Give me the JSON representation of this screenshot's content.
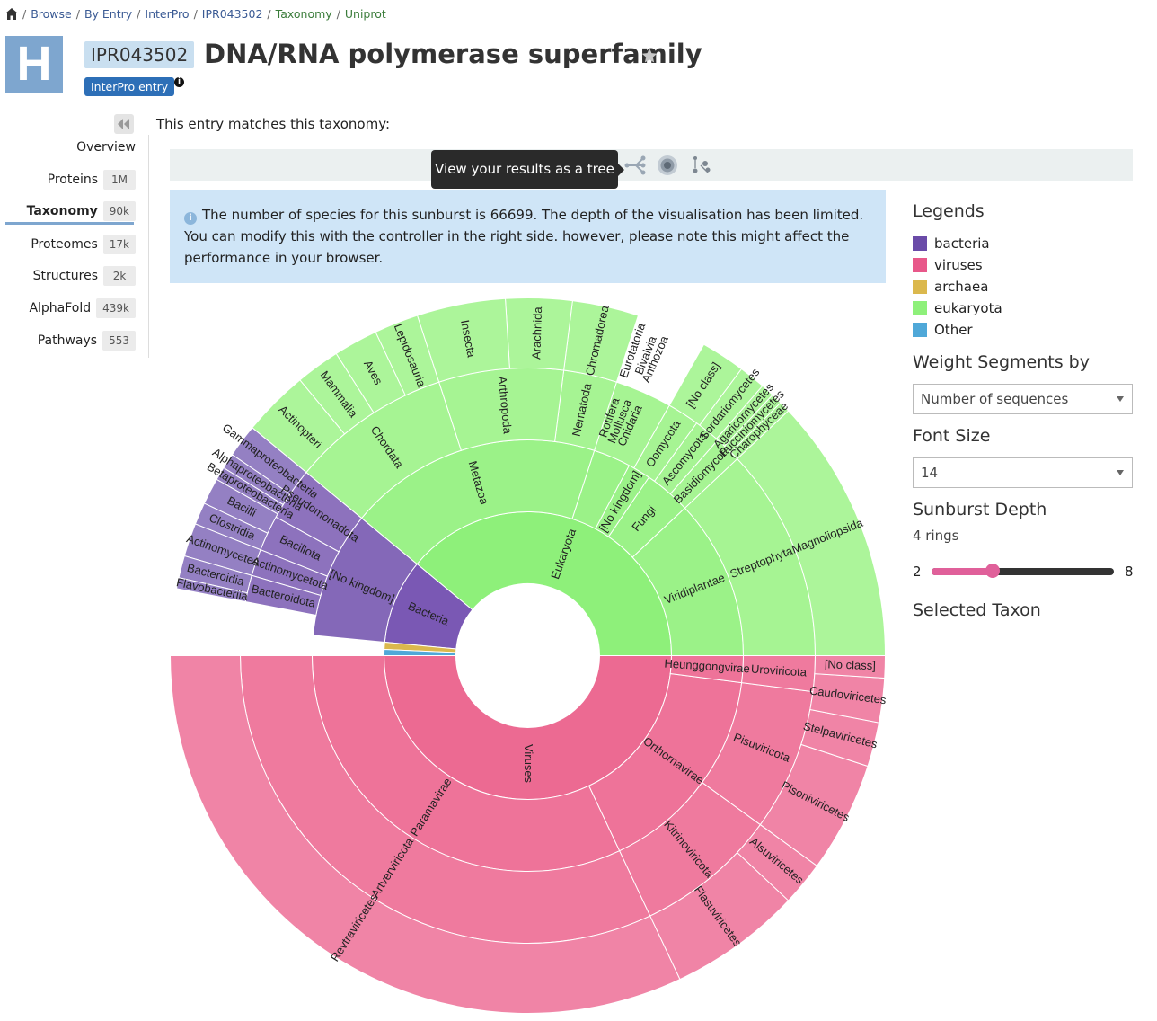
{
  "breadcrumb": [
    "Browse",
    "By Entry",
    "InterPro",
    "IPR043502",
    "Taxonomy",
    "Uniprot"
  ],
  "header": {
    "logo_letter": "H",
    "accession": "IPR043502",
    "title": "DNA/RNA polymerase superfamily",
    "type_badge": "InterPro entry",
    "info_glyph": "i"
  },
  "sidebar": {
    "items": [
      {
        "label": "Overview",
        "count": ""
      },
      {
        "label": "Proteins",
        "count": "1M"
      },
      {
        "label": "Taxonomy",
        "count": "90k"
      },
      {
        "label": "Proteomes",
        "count": "17k"
      },
      {
        "label": "Structures",
        "count": "2k"
      },
      {
        "label": "AlphaFold",
        "count": "439k"
      },
      {
        "label": "Pathways",
        "count": "553"
      }
    ]
  },
  "main": {
    "matches_text": "This entry matches this taxonomy:",
    "tooltip": "View your results as a tree",
    "callout": "The number of species for this sunburst is 66699. The depth of the visualisation has been limited. You can modify this with the controller in the right side. however, please note this might affect the performance in your browser."
  },
  "panel": {
    "legends_title": "Legends",
    "legends": [
      {
        "label": "bacteria",
        "color": "#6a4ba8"
      },
      {
        "label": "viruses",
        "color": "#e8588a"
      },
      {
        "label": "archaea",
        "color": "#dbb84d"
      },
      {
        "label": "eukaryota",
        "color": "#8ef07a"
      },
      {
        "label": "Other",
        "color": "#4fa8d8"
      }
    ],
    "weight_title": "Weight Segments by",
    "weight_value": "Number of sequences",
    "font_title": "Font Size",
    "font_value": "14",
    "depth_title": "Sunburst Depth",
    "depth_value": "4 rings",
    "depth_min": "2",
    "depth_max": "8",
    "depth_current": 4,
    "selected_title": "Selected Taxon"
  },
  "chart_data": {
    "type": "sunburst",
    "rings": [
      [
        {
          "label": "Eukaryota",
          "from": 0.0,
          "to": 0.39,
          "color": "#8ef07a"
        },
        {
          "label": "Bacteria",
          "from": 0.39,
          "to": 0.485,
          "color": "#7a58b4"
        },
        {
          "label": "",
          "from": 0.485,
          "to": 0.493,
          "color": "#dbb84d"
        },
        {
          "label": "",
          "from": 0.493,
          "to": 0.5,
          "color": "#4fa8d8"
        },
        {
          "label": "Viruses",
          "from": 0.5,
          "to": 1.0,
          "color": "#ec6a92"
        }
      ],
      [
        {
          "label": "Viridiplantae",
          "from": 0.0,
          "to": 0.12,
          "color": "#9bf288"
        },
        {
          "label": "Fungi",
          "from": 0.12,
          "to": 0.155,
          "color": "#9bf288"
        },
        {
          "label": "[No kingdom]",
          "from": 0.155,
          "to": 0.172,
          "color": "#9bf288"
        },
        {
          "label": "",
          "from": 0.172,
          "to": 0.2,
          "color": "#9bf288"
        },
        {
          "label": "[No kingdom]",
          "from": 0.39,
          "to": 0.485,
          "color": "#8468b8"
        },
        {
          "label": "Metazoa",
          "from": 0.2,
          "to": 0.39,
          "color": "#9bf288"
        },
        {
          "label": "Paramavirae",
          "from": 0.5,
          "to": 0.82,
          "color": "#ee7399"
        },
        {
          "label": "Orthornavirae",
          "from": 0.82,
          "to": 0.98,
          "color": "#ee7399"
        },
        {
          "label": "Heunggongvirae",
          "from": 0.98,
          "to": 1.0,
          "color": "#ee7399"
        }
      ],
      [
        {
          "label": "Streptophyta",
          "from": 0.0,
          "to": 0.12,
          "color": "#a6f493"
        },
        {
          "label": "Basidiomycota",
          "from": 0.12,
          "to": 0.135,
          "color": "#a6f493"
        },
        {
          "label": "Ascomycota",
          "from": 0.135,
          "to": 0.15,
          "color": "#a6f493"
        },
        {
          "label": "Oomycota",
          "from": 0.15,
          "to": 0.168,
          "color": "#a6f493"
        },
        {
          "label": "",
          "from": 0.168,
          "to": 0.2,
          "color": "#a6f493"
        },
        {
          "label": "Pseudomonadota",
          "from": 0.39,
          "to": 0.42,
          "color": "#8d72bd"
        },
        {
          "label": "Bacillota",
          "from": 0.42,
          "to": 0.44,
          "color": "#8d72bd"
        },
        {
          "label": "Actinomycetota",
          "from": 0.44,
          "to": 0.455,
          "color": "#8d72bd"
        },
        {
          "label": "Bacteroidota",
          "from": 0.455,
          "to": 0.47,
          "color": "#8d72bd"
        },
        {
          "label": "Nematoda",
          "from": 0.2,
          "to": 0.23,
          "color": "#a6f493"
        },
        {
          "label": "Arthropoda",
          "from": 0.23,
          "to": 0.3,
          "color": "#a6f493"
        },
        {
          "label": "Chordata",
          "from": 0.3,
          "to": 0.39,
          "color": "#a6f493"
        },
        {
          "label": "Artverviricota",
          "from": 0.5,
          "to": 0.82,
          "color": "#ef7a9e"
        },
        {
          "label": "Kitrinoviricota",
          "from": 0.82,
          "to": 0.9,
          "color": "#ef7a9e"
        },
        {
          "label": "Pisuviricota",
          "from": 0.9,
          "to": 0.98,
          "color": "#ef7a9e"
        },
        {
          "label": "Uroviricota",
          "from": 0.98,
          "to": 1.0,
          "color": "#ef7a9e"
        }
      ],
      [
        {
          "label": "Magnoliopsida",
          "from": 0.0,
          "to": 0.12,
          "color": "#acf59a"
        },
        {
          "label": "Charophyceae",
          "from": 0.12,
          "to": 0.125,
          "color": "#acf59a"
        },
        {
          "label": "Pucciniomycetes",
          "from": 0.125,
          "to": 0.13,
          "color": "#acf59a"
        },
        {
          "label": "Agaricomycetes",
          "from": 0.13,
          "to": 0.136,
          "color": "#acf59a"
        },
        {
          "label": "Sordariomycetes",
          "from": 0.136,
          "to": 0.148,
          "color": "#acf59a"
        },
        {
          "label": "[No class]",
          "from": 0.148,
          "to": 0.168,
          "color": "#acf59a"
        },
        {
          "label": "Gammaproteobacteria",
          "from": 0.39,
          "to": 0.405,
          "color": "#9480c3"
        },
        {
          "label": "Alphaproteobacteria",
          "from": 0.405,
          "to": 0.412,
          "color": "#9480c3"
        },
        {
          "label": "Betaproteobacteria",
          "from": 0.412,
          "to": 0.418,
          "color": "#9480c3"
        },
        {
          "label": "Bacilli",
          "from": 0.418,
          "to": 0.43,
          "color": "#9480c3"
        },
        {
          "label": "Clostridia",
          "from": 0.43,
          "to": 0.44,
          "color": "#9480c3"
        },
        {
          "label": "Actinomycetes",
          "from": 0.44,
          "to": 0.455,
          "color": "#9480c3"
        },
        {
          "label": "Bacteroidia",
          "from": 0.455,
          "to": 0.465,
          "color": "#9480c3"
        },
        {
          "label": "Flavobacteriia",
          "from": 0.465,
          "to": 0.47,
          "color": "#9480c3"
        },
        {
          "label": "Chromadorea",
          "from": 0.2,
          "to": 0.23,
          "color": "#acf59a"
        },
        {
          "label": "Arachnida",
          "from": 0.23,
          "to": 0.26,
          "color": "#acf59a"
        },
        {
          "label": "Insecta",
          "from": 0.26,
          "to": 0.3,
          "color": "#acf59a"
        },
        {
          "label": "Lepidosauria",
          "from": 0.3,
          "to": 0.32,
          "color": "#acf59a"
        },
        {
          "label": "Aves",
          "from": 0.32,
          "to": 0.34,
          "color": "#acf59a"
        },
        {
          "label": "Mammalia",
          "from": 0.34,
          "to": 0.36,
          "color": "#acf59a"
        },
        {
          "label": "Actinopteri",
          "from": 0.36,
          "to": 0.39,
          "color": "#acf59a"
        },
        {
          "label": "Revtraviricetes",
          "from": 0.5,
          "to": 0.82,
          "color": "#f084a6"
        },
        {
          "label": "Flasuviricetes",
          "from": 0.82,
          "to": 0.88,
          "color": "#f084a6"
        },
        {
          "label": "Alsuviricetes",
          "from": 0.88,
          "to": 0.9,
          "color": "#f084a6"
        },
        {
          "label": "Pisoniviricetes",
          "from": 0.9,
          "to": 0.95,
          "color": "#f084a6"
        },
        {
          "label": "Stelpaviricetes",
          "from": 0.95,
          "to": 0.97,
          "color": "#f084a6"
        },
        {
          "label": "Caudoviricetes",
          "from": 0.97,
          "to": 0.99,
          "color": "#f084a6"
        },
        {
          "label": "[No class]",
          "from": 0.99,
          "to": 1.0,
          "color": "#f084a6"
        }
      ]
    ],
    "extra_labels": [
      {
        "label": "Anthozoa",
        "ring": 3,
        "at": 0.185
      },
      {
        "label": "Bivalvia",
        "ring": 3,
        "at": 0.19
      },
      {
        "label": "Eurotatoria",
        "ring": 3,
        "at": 0.197
      },
      {
        "label": "Cnidaria",
        "ring": 2,
        "at": 0.183
      },
      {
        "label": "Mollusca",
        "ring": 2,
        "at": 0.19
      },
      {
        "label": "Rotifera",
        "ring": 2,
        "at": 0.197
      }
    ]
  }
}
